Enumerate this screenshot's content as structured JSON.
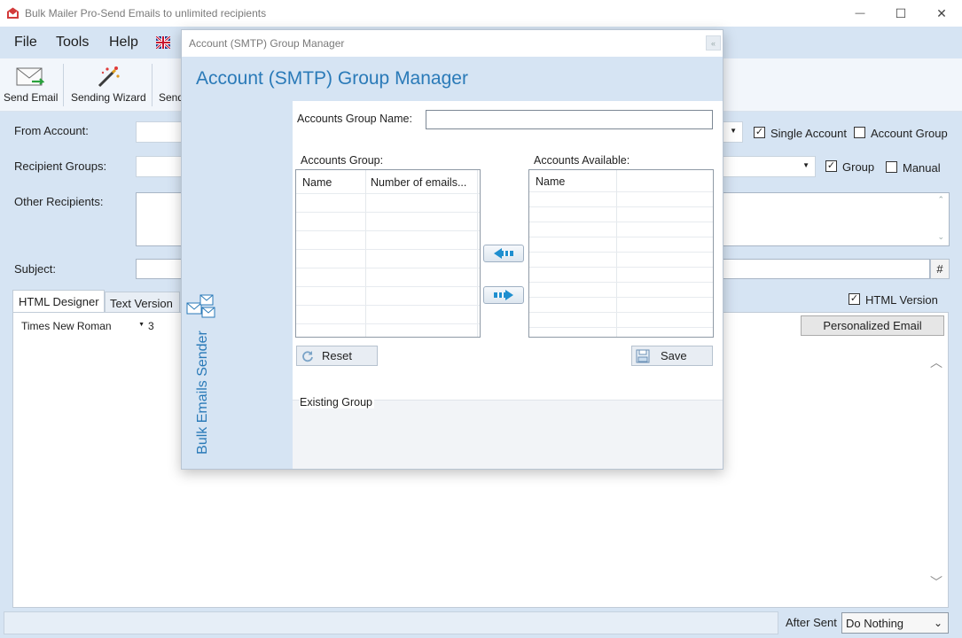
{
  "window": {
    "title": "Bulk Mailer Pro-Send Emails to unlimited recipients",
    "minimize_glyph": "—",
    "maximize_glyph": "☐",
    "close_glyph": "✕"
  },
  "menu": {
    "file": "File",
    "tools": "Tools",
    "help": "Help"
  },
  "toolbar": {
    "send_email": "Send Email",
    "sending_wizard": "Sending Wizard",
    "send_partial": "Send"
  },
  "form": {
    "from_account_label": "From Account:",
    "recipient_groups_label": "Recipient Groups:",
    "other_recipients_label": "Other Recipients:",
    "subject_label": "Subject:",
    "single_account_label": "Single Account",
    "account_group_label": "Account Group",
    "group_label": "Group",
    "manual_label": "Manual",
    "hash_button": "#",
    "html_version_label": "HTML Version",
    "tab_html_designer": "HTML Designer",
    "tab_text_version": "Text Version",
    "font_name": "Times New Roman",
    "font_size": "3",
    "personalized_email": "Personalized Email"
  },
  "dialog": {
    "title": "Account (SMTP) Group Manager",
    "heading": "Account (SMTP) Group Manager",
    "side_text": "Bulk Emails Sender",
    "group_name_label": "Accounts Group Name:",
    "group_name_value": "",
    "accounts_group_label": "Accounts Group:",
    "accounts_available_label": "Accounts Available:",
    "col_name": "Name",
    "col_number_emails": "Number of emails...",
    "col_name_available": "Name",
    "reset_button": "Reset",
    "save_button": "Save",
    "existing_group_label": "Existing Group"
  },
  "status": {
    "after_sent_label": "After Sent",
    "after_sent_value": "Do Nothing"
  },
  "colors": {
    "accent_blue": "#2a7ab8",
    "panel_blue": "#d6e4f3",
    "arrow_blue": "#1f8fcf"
  },
  "icons": {
    "app": "envelope-red-icon",
    "flag": "uk-flag-icon",
    "send_email": "envelope-send-icon",
    "wizard": "magic-wand-icon",
    "reset": "refresh-icon",
    "save": "save-icon",
    "left_arrow": "arrow-left-icon",
    "right_arrow": "arrow-right-icon"
  }
}
